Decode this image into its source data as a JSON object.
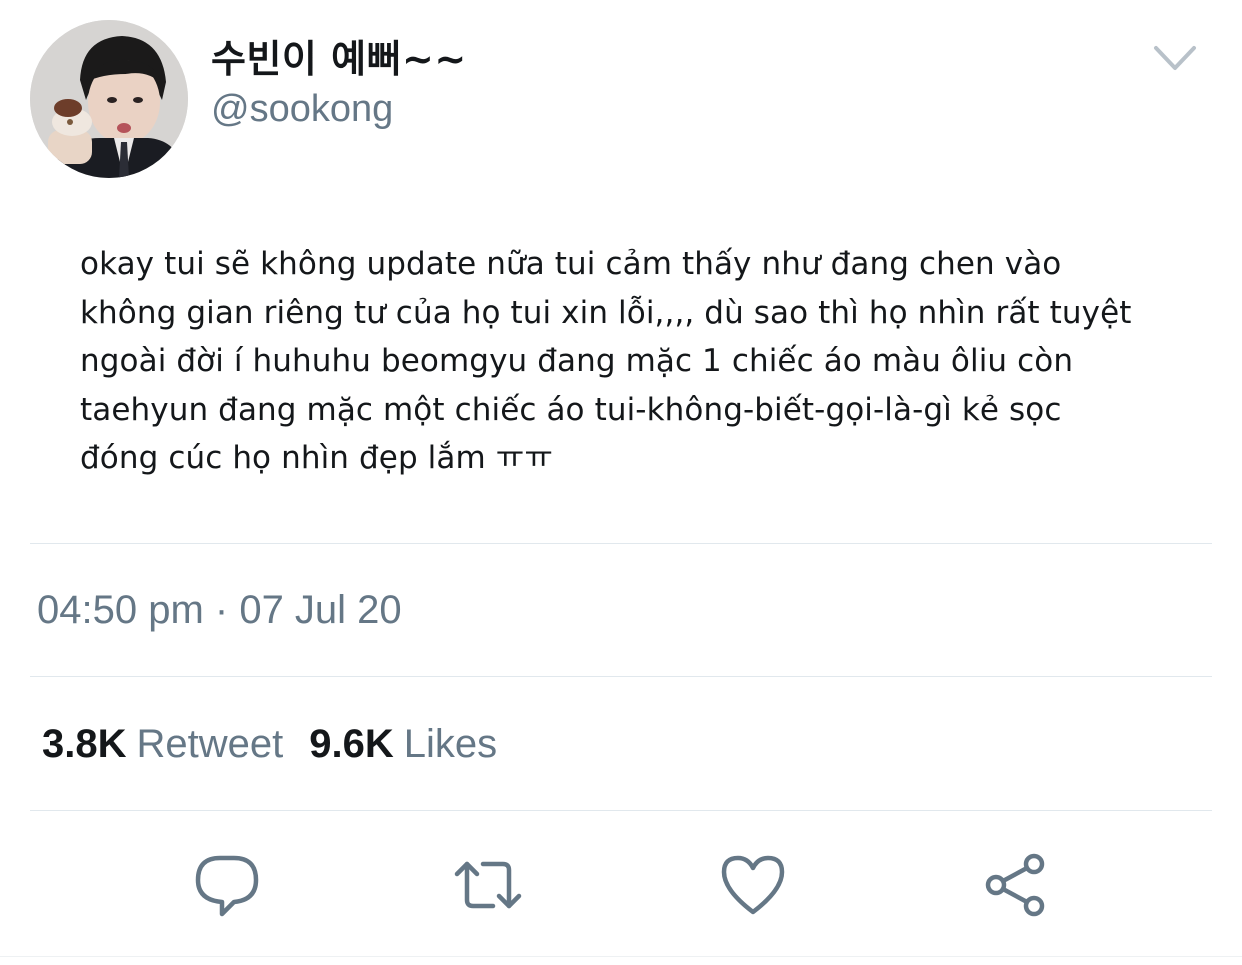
{
  "user": {
    "display_name": "수빈이 예뻐~~",
    "handle": "@sookong",
    "avatar_icon": "profile-photo"
  },
  "tweet": {
    "text": "okay tui sẽ không update nữa tui cảm thấy như đang chen vào\nkhông gian riêng tư của họ tui xin lỗi,,,, dù sao thì họ nhìn rất tuyệt\nngoài đời í huhuhu beomgyu đang mặc 1 chiếc áo màu ôliu còn\ntaehyun đang mặc một chiếc áo tui-không-biết-gọi-là-gì kẻ sọc\nđóng cúc họ nhìn đẹp lắm ㅠㅠ",
    "timestamp": "04:50 pm · 07 Jul 20"
  },
  "stats": {
    "retweets_count": "3.8K",
    "retweets_label": "Retweet",
    "likes_count": "9.6K",
    "likes_label": "Likes"
  },
  "actions": [
    {
      "icon": "reply-icon"
    },
    {
      "icon": "retweet-icon"
    },
    {
      "icon": "like-icon"
    },
    {
      "icon": "share-icon"
    }
  ],
  "colors": {
    "text_primary": "#14171a",
    "text_secondary": "#657786",
    "divider": "#e1e8ed",
    "icon": "#657786"
  }
}
